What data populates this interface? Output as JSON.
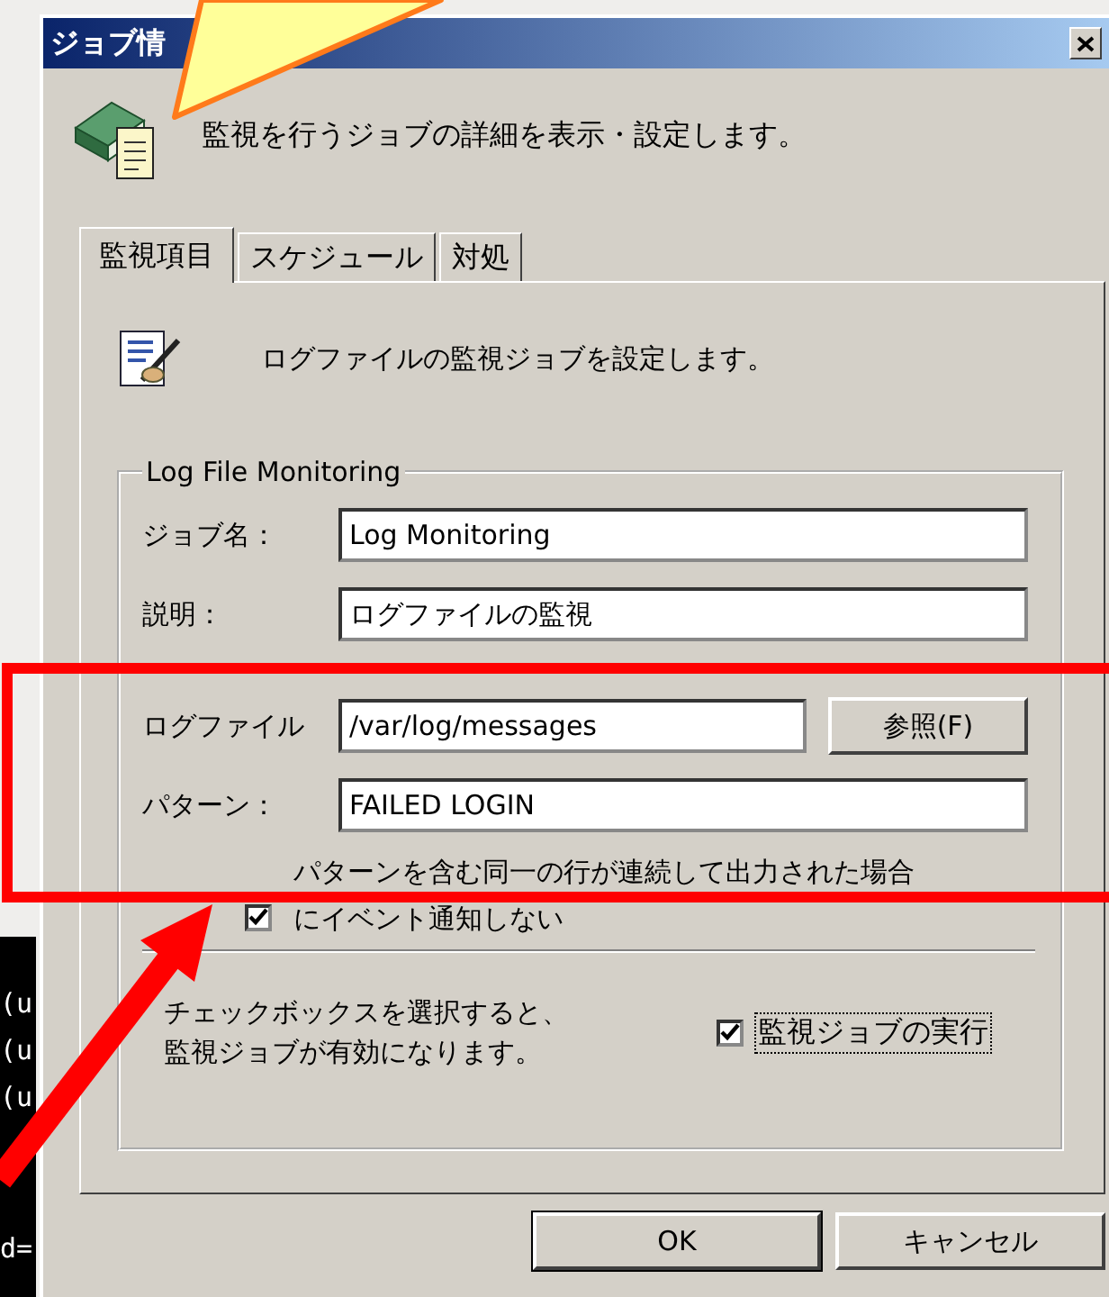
{
  "terminal": {
    "lines": [
      "(u",
      "(u",
      "(u",
      "d="
    ]
  },
  "window": {
    "title": "ジョブ情"
  },
  "header": {
    "text": "監視を行うジョブの詳細を表示・設定します。"
  },
  "tabs": [
    {
      "label": "監視項目",
      "selected": true
    },
    {
      "label": "スケジュール",
      "selected": false
    },
    {
      "label": "対処",
      "selected": false
    }
  ],
  "panel": {
    "description": "ログファイルの監視ジョブを設定します。",
    "group": {
      "legend": "Log File Monitoring",
      "fields": [
        {
          "label": "ジョブ名：",
          "value": "Log Monitoring"
        },
        {
          "label": "説明：",
          "value": "ログファイルの監視"
        }
      ],
      "logfile": {
        "label": "ログファイル",
        "value": "/var/log/messages",
        "button": "参照(F)"
      },
      "pattern": {
        "label": "パターン：",
        "value": "FAILED LOGIN"
      },
      "suppress": {
        "label_lines": [
          "パターンを含む同一の行が連続して出力された場合",
          "にイベント通知しない"
        ],
        "checked": true
      },
      "enable": {
        "note_lines": [
          "チェックボックスを選択すると、",
          "監視ジョブが有効になります。"
        ],
        "label": "監視ジョブの実行",
        "checked": true
      }
    }
  },
  "buttons": [
    {
      "label": "OK",
      "default": true
    },
    {
      "label": "キャンセル",
      "default": false
    }
  ]
}
